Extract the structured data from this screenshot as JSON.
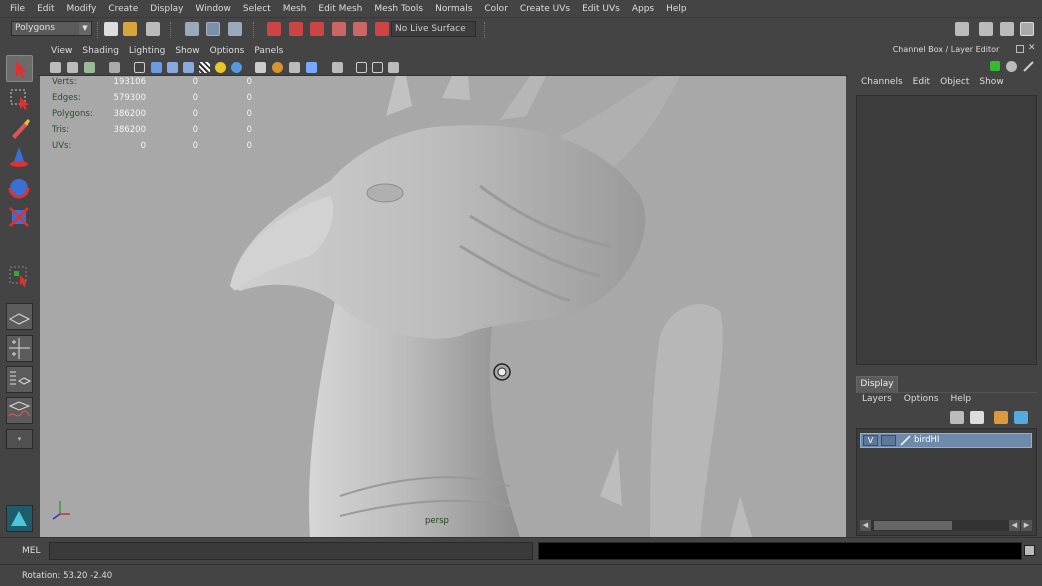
{
  "menubar": {
    "items": [
      "File",
      "Edit",
      "Modify",
      "Create",
      "Display",
      "Window",
      "Select",
      "Mesh",
      "Edit Mesh",
      "Mesh Tools",
      "Normals",
      "Color",
      "Create UVs",
      "Edit UVs",
      "Apps",
      "Help"
    ]
  },
  "statusline": {
    "mode_menu": "Polygons",
    "live_surface": "No Live Surface"
  },
  "panel": {
    "menu": [
      "View",
      "Shading",
      "Lighting",
      "Show",
      "Options",
      "Panels"
    ]
  },
  "hud": {
    "rows": [
      {
        "label": "Verts:",
        "values": [
          "193106",
          "0",
          "0"
        ]
      },
      {
        "label": "Edges:",
        "values": [
          "579300",
          "0",
          "0"
        ]
      },
      {
        "label": "Polygons:",
        "values": [
          "386200",
          "0",
          "0"
        ]
      },
      {
        "label": "Tris:",
        "values": [
          "386200",
          "0",
          "0"
        ]
      },
      {
        "label": "UVs:",
        "values": [
          "0",
          "0",
          "0"
        ]
      }
    ],
    "camera_label": "persp"
  },
  "channelbox": {
    "title": "Channel Box / Layer Editor",
    "menu": [
      "Channels",
      "Edit",
      "Object",
      "Show"
    ]
  },
  "layers": {
    "tab": "Display",
    "menu": [
      "Layers",
      "Options",
      "Help"
    ],
    "layer_visible": "V",
    "layer_name": "birdHI"
  },
  "cmdline": {
    "label": "MEL"
  },
  "helpline": {
    "text": "Rotation:  53.20  -2.40"
  },
  "colors": {
    "ui_bg": "#444444",
    "viewport_bg": "#a8a8a8",
    "hud_label": "#2b4e2b",
    "layer_selected": "#6e8aab"
  }
}
